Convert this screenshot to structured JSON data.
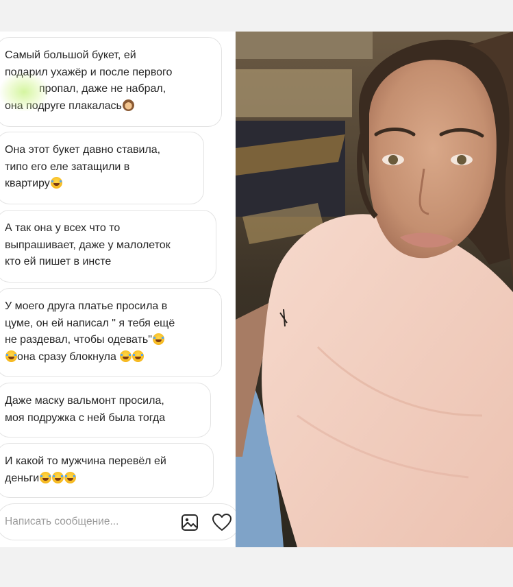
{
  "messages": [
    {
      "lines": [
        "Самый большой букет, ей",
        "подарил ухажёр и после первого",
        "",
        "она подруге плакалась"
      ],
      "emoji": [
        "see-no-evil-monkey"
      ]
    },
    {
      "lines": [
        "Она этот букет давно ставила,",
        "типо его еле затащили в",
        "квартиру"
      ],
      "emoji": [
        "crying-face"
      ]
    },
    {
      "lines": [
        "А так она у всех что то",
        "выпрашивает, даже у малолеток",
        "кто ей пишет в инсте"
      ]
    },
    {
      "lines": [
        "У моего друга платье просила в",
        "цуме, он ей написал \" я тебя ещё",
        "не раздевал, чтобы одевать\"",
        "она сразу блокнула"
      ],
      "emoji": [
        "tears-of-joy",
        "tears-of-joy",
        "tears-of-joy",
        "tears-of-joy"
      ]
    },
    {
      "lines": [
        "Даже маску вальмонт просила,",
        "моя подружка с ней была тогда"
      ]
    },
    {
      "lines": [
        "И какой то мужчина перевёл ей",
        "деньги"
      ],
      "emoji": [
        "tears-of-joy",
        "tears-of-joy",
        "tears-of-joy"
      ]
    }
  ],
  "partial_text": "пропал, даже не набрал,",
  "composer": {
    "placeholder": "Написать сообщение...",
    "icons": [
      "image-icon",
      "heart-icon"
    ]
  },
  "photo": {
    "icon": "selfie-photo"
  },
  "colors": {
    "bubble_border": "#e3e3e3",
    "text": "#262626",
    "placeholder": "#9b9b9b",
    "background": "#f2f2f2"
  }
}
